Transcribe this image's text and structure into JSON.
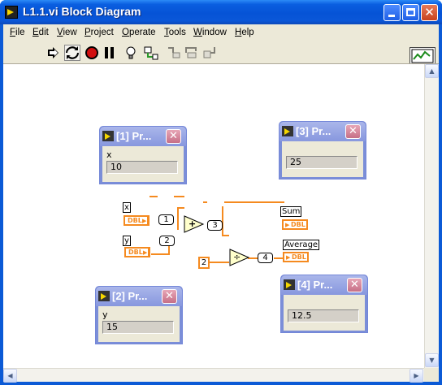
{
  "window": {
    "title": "L1.1.vi Block Diagram"
  },
  "menu": {
    "items": [
      "File",
      "Edit",
      "View",
      "Project",
      "Operate",
      "Tools",
      "Window",
      "Help"
    ]
  },
  "toolbar": {
    "buttons": [
      "run-arrow",
      "run-continuously",
      "abort",
      "pause",
      "highlight-execution",
      "retain-wire-values",
      "step-into",
      "step-over",
      "step-out"
    ]
  },
  "probes": [
    {
      "title": "[1] Pr...",
      "name": "x",
      "value": "10"
    },
    {
      "title": "[3] Pr...",
      "name": "",
      "value": "25"
    },
    {
      "title": "[2] Pr...",
      "name": "y",
      "value": "15"
    },
    {
      "title": "[4] Pr...",
      "name": "",
      "value": "12.5"
    }
  ],
  "diagram": {
    "controls": [
      {
        "label": "x",
        "type": "DBL"
      },
      {
        "label": "y",
        "type": "DBL"
      }
    ],
    "indicators": [
      {
        "label": "Sum",
        "type": "DBL"
      },
      {
        "label": "Average",
        "type": "DBL"
      }
    ],
    "constant": "2",
    "add_symbol": "+",
    "divide_symbol": "÷",
    "wire_probes": [
      "1",
      "2",
      "3",
      "4"
    ]
  },
  "colors": {
    "titlebar": "#0653d6",
    "probe_title": "#8797de",
    "wire_dbl": "#f58a1f"
  }
}
